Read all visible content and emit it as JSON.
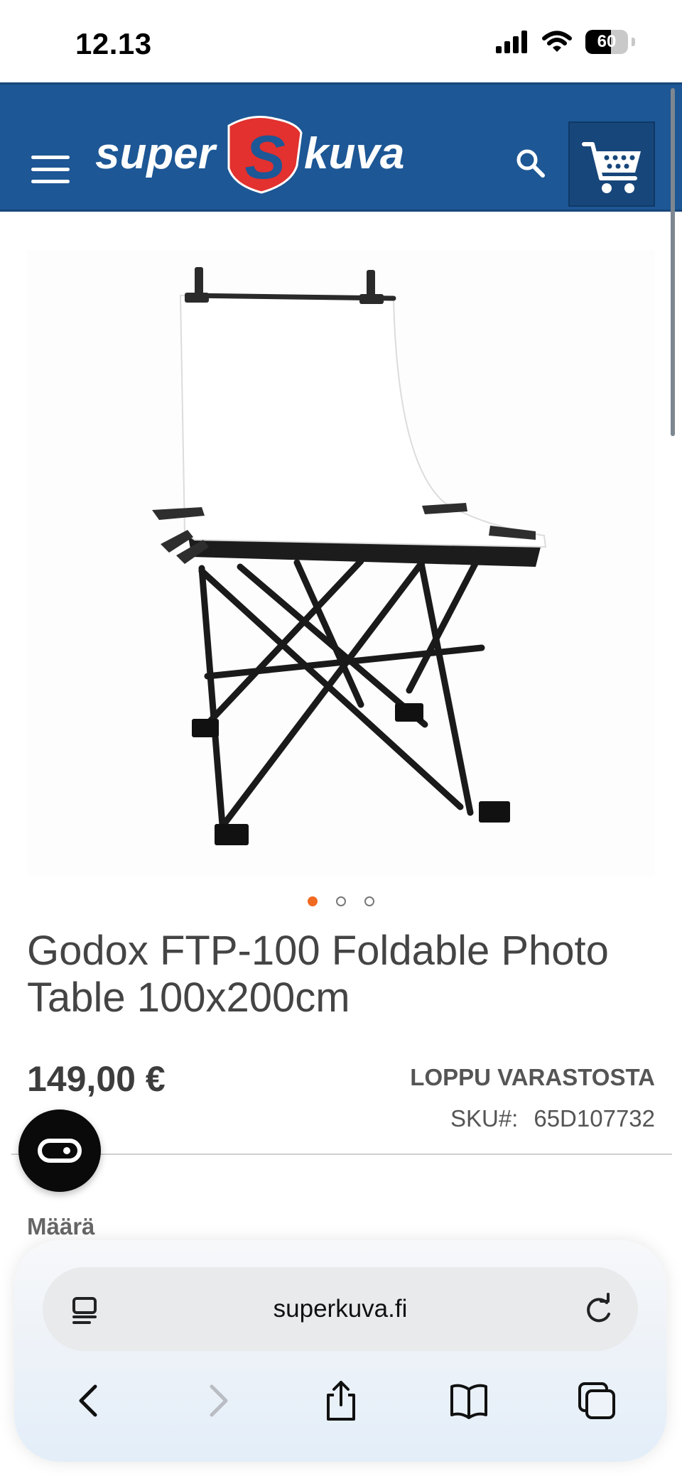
{
  "status_bar": {
    "time": "12.13",
    "battery_level": "60",
    "battery_fraction": 0.6
  },
  "header": {
    "logo": {
      "word_left": "super",
      "letter": "S",
      "word_right": "kuva"
    },
    "colors": {
      "header": "#1d5795",
      "logo_red": "#e2312f",
      "white": "#ffffff"
    }
  },
  "gallery": {
    "image_count": 3,
    "active_index": 0,
    "accent": "#f06a22"
  },
  "product": {
    "title": "Godox FTP-100 Foldable Photo Table 100x200cm",
    "price": "149,00 €",
    "stock_status": "LOPPU VARASTOSTA",
    "sku_label": "SKU#:",
    "sku_value": "65D107732",
    "quantity_label": "Määrä"
  },
  "browser": {
    "url": "superkuva.fi"
  },
  "icons": [
    "signal-icon",
    "wifi-icon",
    "battery-icon",
    "menu-icon",
    "search-icon",
    "cart-icon",
    "chat-icon",
    "reader-icon",
    "reload-icon",
    "back-icon",
    "forward-icon",
    "share-icon",
    "bookmarks-icon",
    "tabs-icon"
  ]
}
